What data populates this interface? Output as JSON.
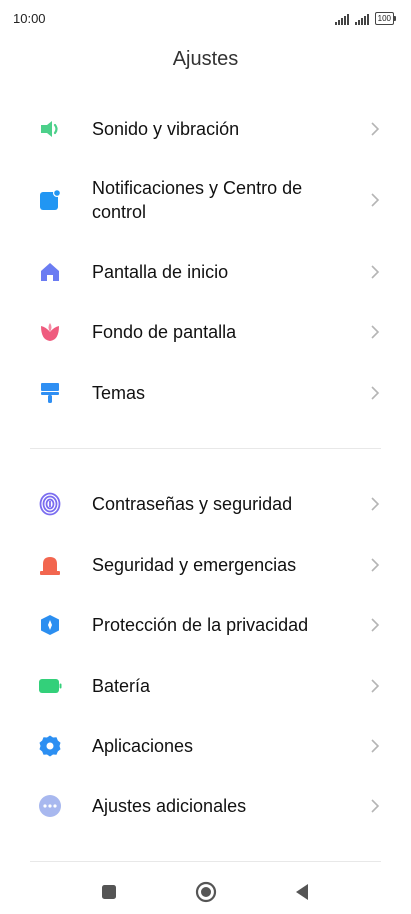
{
  "status_bar": {
    "time": "10:00",
    "battery": "100"
  },
  "page_title": "Ajustes",
  "menu_groups": [
    {
      "items": [
        {
          "label": "Sonido y vibración",
          "icon": "speaker-icon",
          "color": "#4cd08a"
        },
        {
          "label": "Notificaciones y Centro de control",
          "icon": "notification-icon",
          "color": "#2196f3"
        },
        {
          "label": "Pantalla de inicio",
          "icon": "home-icon",
          "color": "#6b7cf2"
        },
        {
          "label": "Fondo de pantalla",
          "icon": "wallpaper-icon",
          "color": "#ef5b7e"
        },
        {
          "label": "Temas",
          "icon": "themes-icon",
          "color": "#2f8ff3"
        }
      ]
    },
    {
      "items": [
        {
          "label": "Contraseñas y seguridad",
          "icon": "fingerprint-icon",
          "color": "#7a6cf0"
        },
        {
          "label": "Seguridad y emergencias",
          "icon": "emergency-icon",
          "color": "#f2664f"
        },
        {
          "label": "Protección de la privacidad",
          "icon": "privacy-icon",
          "color": "#2b8ef0"
        },
        {
          "label": "Batería",
          "icon": "battery-icon",
          "color": "#33d07a"
        },
        {
          "label": "Aplicaciones",
          "icon": "apps-gear-icon",
          "color": "#2c8ff2"
        },
        {
          "label": "Ajustes adicionales",
          "icon": "more-icon",
          "color": "#a8b8ef"
        }
      ]
    }
  ],
  "nav_bar": {
    "buttons": [
      "recents-button",
      "home-button",
      "back-button"
    ]
  }
}
